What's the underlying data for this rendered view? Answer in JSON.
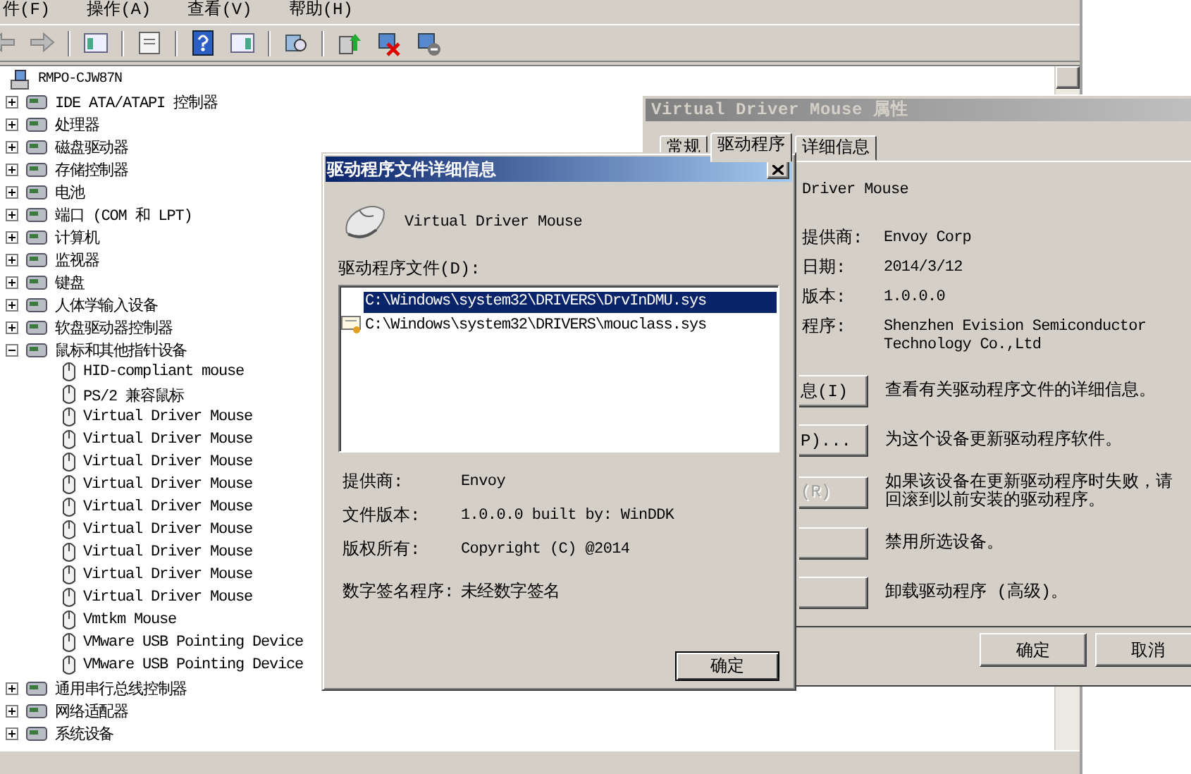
{
  "main_window": {
    "menu": [
      "件(F)",
      "操作(A)",
      "查看(V)",
      "帮助(H)"
    ],
    "tree": {
      "name": "RMPO-CJW87N",
      "children": [
        {
          "name": "IDE ATA/ATAPI 控制器",
          "expanded": false
        },
        {
          "name": "处理器",
          "expanded": false
        },
        {
          "name": "磁盘驱动器",
          "expanded": false
        },
        {
          "name": "存储控制器",
          "expanded": false
        },
        {
          "name": "电池",
          "expanded": false
        },
        {
          "name": "端口 (COM 和 LPT)",
          "expanded": false
        },
        {
          "name": "计算机",
          "expanded": false
        },
        {
          "name": "监视器",
          "expanded": false
        },
        {
          "name": "键盘",
          "expanded": false
        },
        {
          "name": "人体学输入设备",
          "expanded": false
        },
        {
          "name": "软盘驱动器控制器",
          "expanded": false
        },
        {
          "name": "鼠标和其他指针设备",
          "expanded": true,
          "children": [
            {
              "name": "HID-compliant mouse"
            },
            {
              "name": "PS/2 兼容鼠标"
            },
            {
              "name": "Virtual Driver Mouse"
            },
            {
              "name": "Virtual Driver Mouse"
            },
            {
              "name": "Virtual Driver Mouse"
            },
            {
              "name": "Virtual Driver Mouse"
            },
            {
              "name": "Virtual Driver Mouse"
            },
            {
              "name": "Virtual Driver Mouse"
            },
            {
              "name": "Virtual Driver Mouse"
            },
            {
              "name": "Virtual Driver Mouse"
            },
            {
              "name": "Virtual Driver Mouse"
            },
            {
              "name": "Vmtkm Mouse"
            },
            {
              "name": "VMware USB Pointing Device"
            },
            {
              "name": "VMware USB Pointing Device"
            }
          ]
        },
        {
          "name": "通用串行总线控制器",
          "expanded": false
        },
        {
          "name": "网络适配器",
          "expanded": false
        },
        {
          "name": "系统设备",
          "expanded": false
        }
      ]
    }
  },
  "properties_window": {
    "title": "Virtual Driver Mouse 属性",
    "tabs": [
      {
        "label": "常规",
        "selected": false
      },
      {
        "label": "驱动程序",
        "selected": true
      },
      {
        "label": "详细信息",
        "selected": false
      }
    ],
    "device_name": "Driver Mouse",
    "fields": [
      {
        "label": "提供商:",
        "value": "Envoy Corp"
      },
      {
        "label": "日期:",
        "value": "2014/3/12"
      },
      {
        "label": "版本:",
        "value": "1.0.0.0"
      },
      {
        "label": "程序:",
        "value": "Shenzhen Evision Semiconductor Technology Co.,Ltd"
      }
    ],
    "actions": [
      {
        "button": "息(I)",
        "disabled": false,
        "description": "查看有关驱动程序文件的详细信息。"
      },
      {
        "button": "P)...",
        "disabled": false,
        "description": "为这个设备更新驱动程序软件。"
      },
      {
        "button": "(R)",
        "disabled": true,
        "description": "如果该设备在更新驱动程序时失败，请回滚到以前安装的驱动程序。"
      },
      {
        "description": "禁用所选设备。"
      },
      {
        "description": "卸载驱动程序 (高级)。"
      }
    ],
    "buttons": [
      "确定",
      "取消"
    ]
  },
  "details_dialog": {
    "title": "驱动程序文件详细信息",
    "device_name": "Virtual Driver Mouse",
    "files_label": "驱动程序文件(D):",
    "files": [
      {
        "path": "C:\\Windows\\system32\\DRIVERS\\DrvInDMU.sys",
        "selected": true,
        "signed": false
      },
      {
        "path": "C:\\Windows\\system32\\DRIVERS\\mouclass.sys",
        "selected": false,
        "signed": true
      }
    ],
    "fields": [
      {
        "label": "提供商:",
        "value": "Envoy"
      },
      {
        "label": "文件版本:",
        "value": "1.0.0.0 built by: WinDDK"
      },
      {
        "label": "版权所有:",
        "value": "Copyright (C) @2014"
      },
      {
        "label": "数字签名程序:",
        "value": "未经数字签名"
      }
    ],
    "ok": "确定"
  }
}
